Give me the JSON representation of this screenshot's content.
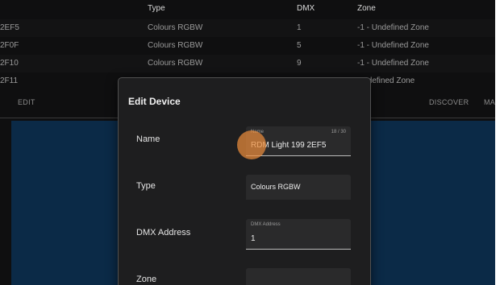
{
  "table": {
    "headers": {
      "type": "Type",
      "dmx": "DMX",
      "zone": "Zone"
    },
    "rows": [
      {
        "id": "2EF5",
        "type": "Colours RGBW",
        "dmx": "1",
        "zone": "-1 - Undefined Zone"
      },
      {
        "id": "2F0F",
        "type": "Colours RGBW",
        "dmx": "5",
        "zone": "-1 - Undefined Zone"
      },
      {
        "id": "2F10",
        "type": "Colours RGBW",
        "dmx": "9",
        "zone": "-1 - Undefined Zone"
      },
      {
        "id": "2F11",
        "zone": "Undefined Zone"
      }
    ]
  },
  "toolbar": {
    "edit": "EDIT",
    "discover": "DISCOVER",
    "more": "MA"
  },
  "dialog": {
    "title": "Edit Device",
    "name": {
      "label": "Name",
      "field_label": "Name",
      "value": "RDM Light 199 2EF5",
      "counter": "18 / 30"
    },
    "type": {
      "label": "Type",
      "value": "Colours RGBW"
    },
    "dmx": {
      "label": "DMX Address",
      "field_label": "DMX Address",
      "value": "1"
    },
    "zone": {
      "label": "Zone",
      "value": ""
    }
  },
  "colors": {
    "ripple": "#ea8c3c",
    "lower_panel": "#0b2a47",
    "dialog_bg": "#1e1e1f"
  }
}
